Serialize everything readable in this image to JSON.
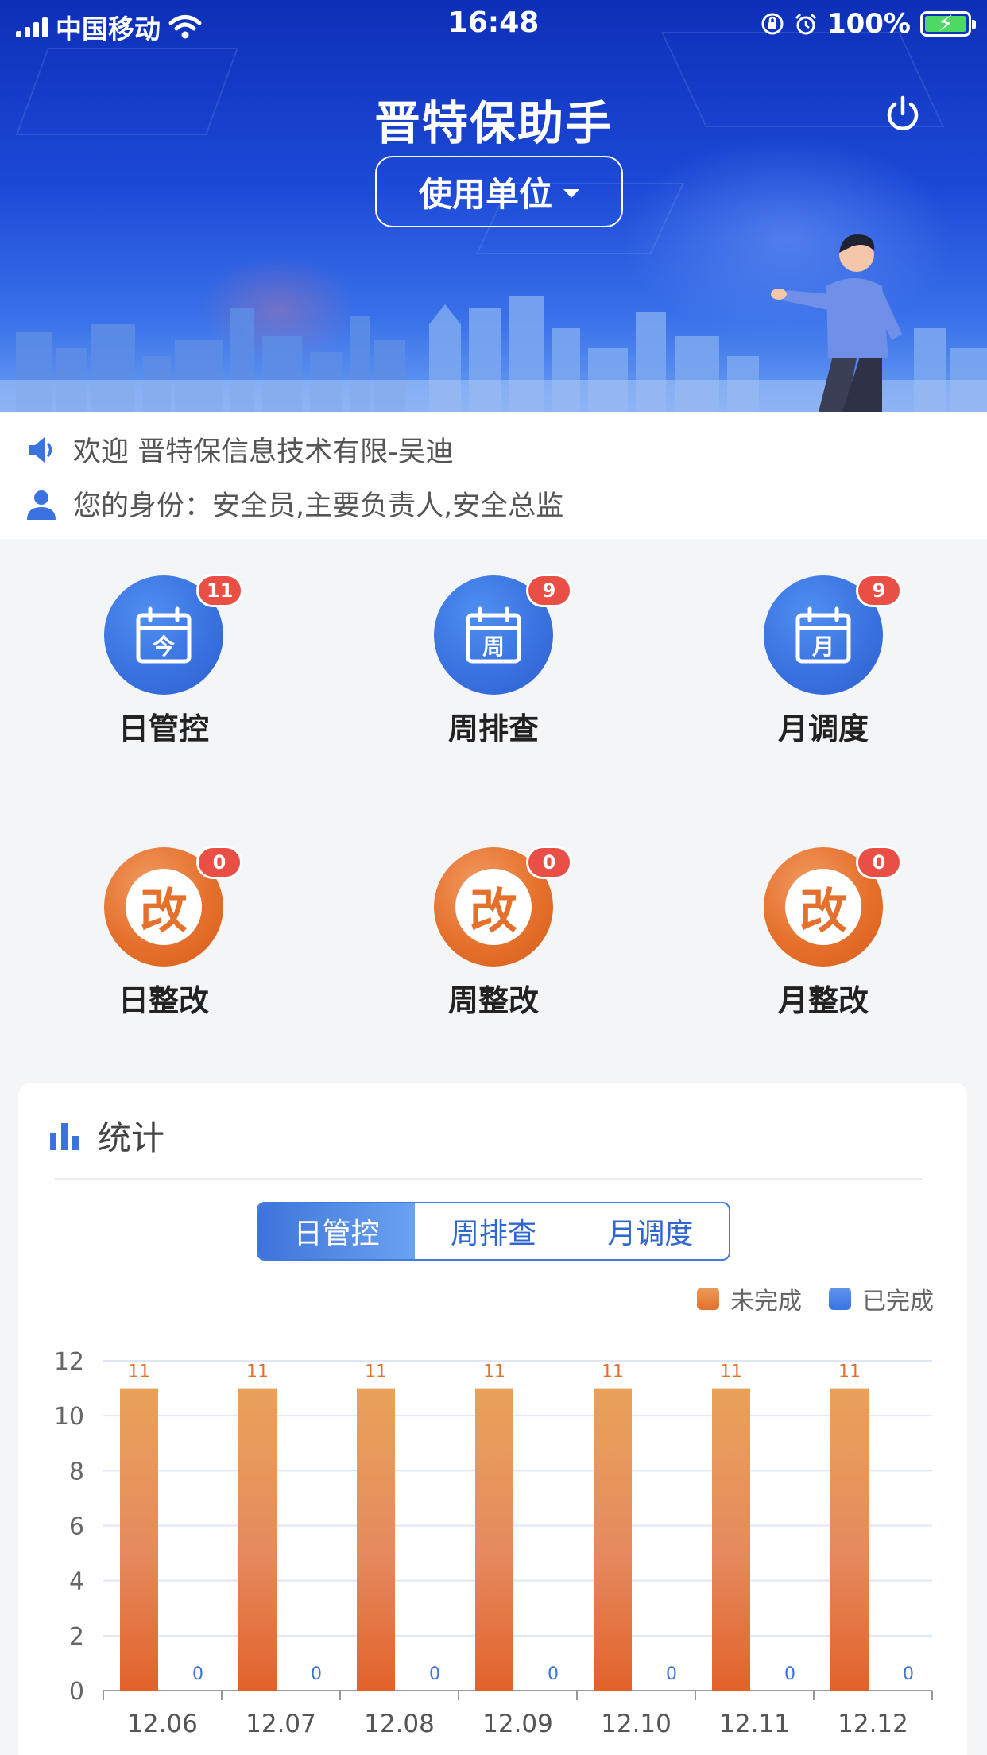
{
  "status_bar": {
    "carrier": "中国移动",
    "time": "16:48",
    "battery": "100%"
  },
  "header": {
    "title": "晋特保助手",
    "unit_select": "使用单位"
  },
  "welcome": {
    "greeting": "欢迎 晋特保信息技术有限-吴迪",
    "identity": "您的身份：安全员,主要负责人,安全总监"
  },
  "menu": [
    {
      "label": "日管控",
      "badge": "11",
      "icon": "calendar-today-icon",
      "glyph": "今",
      "color": "#3a73e0"
    },
    {
      "label": "周排查",
      "badge": "9",
      "icon": "calendar-week-icon",
      "glyph": "周",
      "color": "#3a73e0"
    },
    {
      "label": "月调度",
      "badge": "9",
      "icon": "calendar-month-icon",
      "glyph": "月",
      "color": "#3a73e0"
    },
    {
      "label": "日整改",
      "badge": "0",
      "icon": "rectify-icon",
      "glyph": "改",
      "color": "#e5702c"
    },
    {
      "label": "周整改",
      "badge": "0",
      "icon": "rectify-icon",
      "glyph": "改",
      "color": "#e5702c"
    },
    {
      "label": "月整改",
      "badge": "0",
      "icon": "rectify-icon",
      "glyph": "改",
      "color": "#e5702c"
    }
  ],
  "stats": {
    "title": "统计",
    "tabs": [
      "日管控",
      "周排查",
      "月调度"
    ],
    "active_tab": 0,
    "legend": [
      "未完成",
      "已完成"
    ]
  },
  "chart_data": {
    "type": "bar",
    "categories": [
      "12.06",
      "12.07",
      "12.08",
      "12.09",
      "12.10",
      "12.11",
      "12.12"
    ],
    "series": [
      {
        "name": "未完成",
        "values": [
          11,
          11,
          11,
          11,
          11,
          11,
          11
        ],
        "color": "#e5702c"
      },
      {
        "name": "已完成",
        "values": [
          0,
          0,
          0,
          0,
          0,
          0,
          0
        ],
        "color": "#3a73e0"
      }
    ],
    "ylim": [
      0,
      12
    ],
    "yticks": [
      0,
      2,
      4,
      6,
      8,
      10,
      12
    ],
    "grid": true,
    "legend_position": "top-right"
  }
}
